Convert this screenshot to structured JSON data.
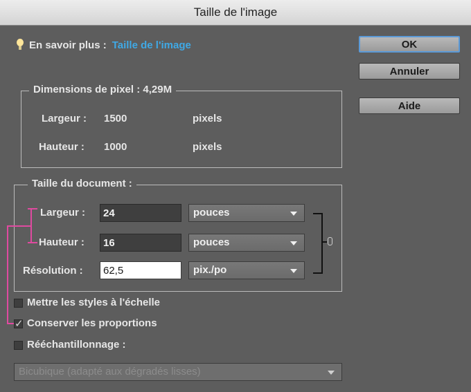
{
  "window": {
    "title": "Taille de l'image"
  },
  "hint": {
    "prefix": "En savoir plus :",
    "link": "Taille de l'image"
  },
  "buttons": {
    "ok": "OK",
    "cancel": "Annuler",
    "help": "Aide"
  },
  "pixel_dimensions": {
    "legend": "Dimensions de pixel :",
    "size": "4,29M",
    "width_label": "Largeur :",
    "width_value": "1500",
    "width_unit": "pixels",
    "height_label": "Hauteur :",
    "height_value": "1000",
    "height_unit": "pixels"
  },
  "document_size": {
    "legend": "Taille du document :",
    "width_label": "Largeur :",
    "width_value": "24",
    "width_unit": "pouces",
    "height_label": "Hauteur :",
    "height_value": "16",
    "height_unit": "pouces",
    "resolution_label": "Résolution :",
    "resolution_value": "62,5",
    "resolution_unit": "pix./po"
  },
  "options": {
    "scale_styles": {
      "label": "Mettre les styles à l'échelle",
      "checked": false
    },
    "constrain": {
      "label": "Conserver les proportions",
      "checked": true
    },
    "resample": {
      "label": "Rééchantillonnage :",
      "checked": false
    },
    "resample_method": "Bicubique (adapté aux dégradés lisses)"
  },
  "colors": {
    "accent_link": "#3fa9e6",
    "annotation": "#e04aa0"
  }
}
